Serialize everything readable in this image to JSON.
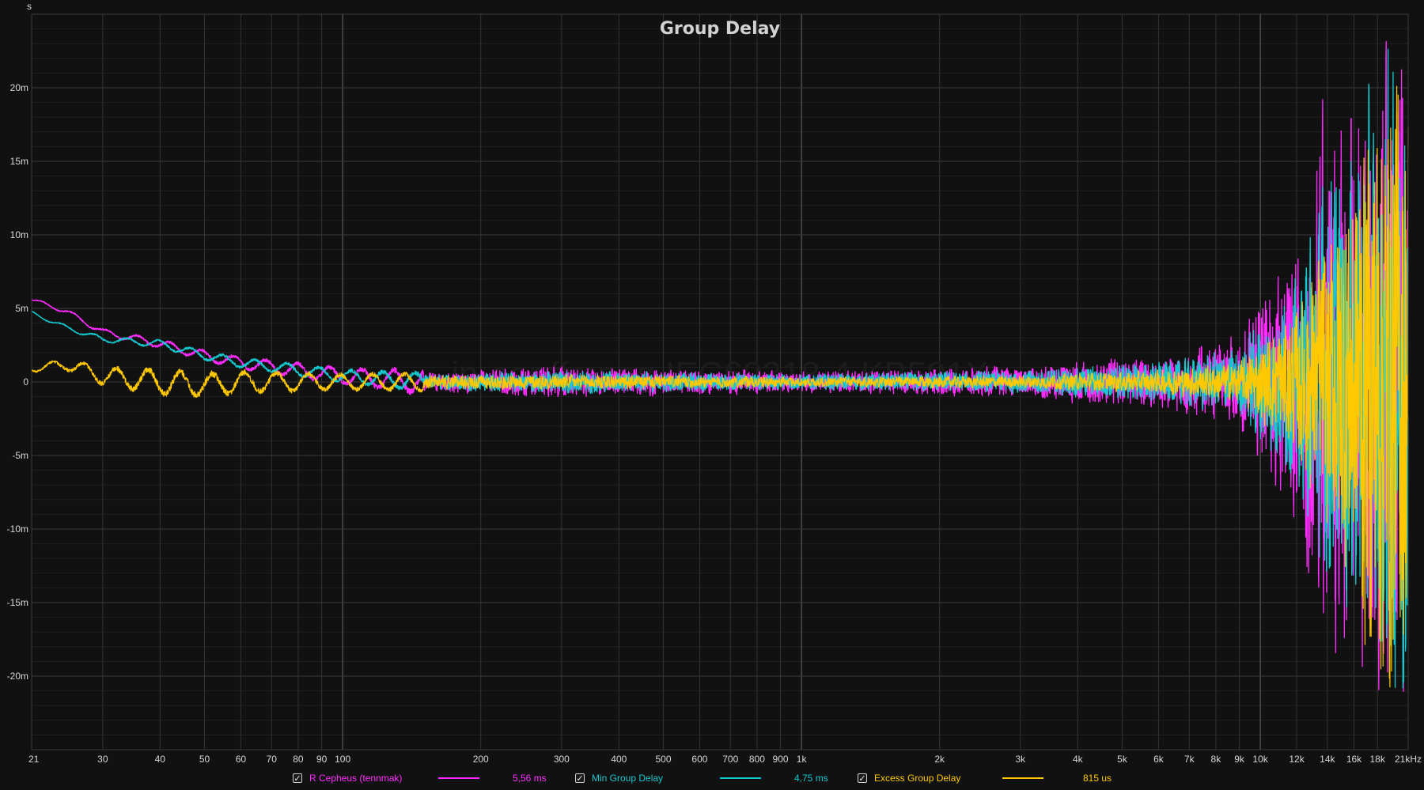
{
  "chart_data": {
    "type": "line",
    "title": "Group Delay",
    "ylabel": "s",
    "watermark": "in-ear ffmpeg IEC60318-4 KB501X",
    "x_scale": "log",
    "xlim": [
      21,
      21000
    ],
    "ylim": [
      -0.025,
      0.025
    ],
    "x_ticks": [
      {
        "v": 21,
        "label": "21"
      },
      {
        "v": 30,
        "label": "30"
      },
      {
        "v": 40,
        "label": "40"
      },
      {
        "v": 50,
        "label": "50"
      },
      {
        "v": 60,
        "label": "60"
      },
      {
        "v": 70,
        "label": "70"
      },
      {
        "v": 80,
        "label": "80"
      },
      {
        "v": 90,
        "label": "90"
      },
      {
        "v": 100,
        "label": "100"
      },
      {
        "v": 200,
        "label": "200"
      },
      {
        "v": 300,
        "label": "300"
      },
      {
        "v": 400,
        "label": "400"
      },
      {
        "v": 500,
        "label": "500"
      },
      {
        "v": 600,
        "label": "600"
      },
      {
        "v": 700,
        "label": "700"
      },
      {
        "v": 800,
        "label": "800"
      },
      {
        "v": 900,
        "label": "900"
      },
      {
        "v": 1000,
        "label": "1k"
      },
      {
        "v": 2000,
        "label": "2k"
      },
      {
        "v": 3000,
        "label": "3k"
      },
      {
        "v": 4000,
        "label": "4k"
      },
      {
        "v": 5000,
        "label": "5k"
      },
      {
        "v": 6000,
        "label": "6k"
      },
      {
        "v": 7000,
        "label": "7k"
      },
      {
        "v": 8000,
        "label": "8k"
      },
      {
        "v": 9000,
        "label": "9k"
      },
      {
        "v": 10000,
        "label": "10k"
      },
      {
        "v": 12000,
        "label": "12k"
      },
      {
        "v": 14000,
        "label": "14k"
      },
      {
        "v": 16000,
        "label": "16k"
      },
      {
        "v": 18000,
        "label": "18k"
      },
      {
        "v": 21000,
        "label": "21kHz"
      }
    ],
    "y_ticks": [
      {
        "v": 0.02,
        "label": "20m"
      },
      {
        "v": 0.015,
        "label": "15m"
      },
      {
        "v": 0.01,
        "label": "10m"
      },
      {
        "v": 0.005,
        "label": "5m"
      },
      {
        "v": 0,
        "label": "0"
      },
      {
        "v": -0.005,
        "label": "-5m"
      },
      {
        "v": -0.01,
        "label": "-10m"
      },
      {
        "v": -0.015,
        "label": "-15m"
      },
      {
        "v": -0.02,
        "label": "-20m"
      }
    ],
    "grid": true,
    "legend_position": "bottom",
    "series": [
      {
        "name": "R Cepheus (tennmak)",
        "value_label": "5,56 ms",
        "color": "#ff2bff",
        "trend": [
          [
            21,
            0.0056
          ],
          [
            25,
            0.0048
          ],
          [
            30,
            0.0034
          ],
          [
            40,
            0.0026
          ],
          [
            50,
            0.0018
          ],
          [
            60,
            0.0013
          ],
          [
            80,
            0.0008
          ],
          [
            100,
            0.0004
          ],
          [
            150,
            0
          ],
          [
            21000,
            0
          ]
        ],
        "envelope": [
          [
            21,
            0.0001
          ],
          [
            100,
            0.0005
          ],
          [
            300,
            0.0012
          ],
          [
            1000,
            0.0008
          ],
          [
            3000,
            0.0012
          ],
          [
            6000,
            0.0022
          ],
          [
            9000,
            0.0035
          ],
          [
            10000,
            0.0075
          ],
          [
            12000,
            0.011
          ],
          [
            14000,
            0.022
          ],
          [
            16000,
            0.022
          ],
          [
            18000,
            0.025
          ],
          [
            21000,
            0.025
          ]
        ]
      },
      {
        "name": "Min Group Delay",
        "value_label": "4,75 ms",
        "color": "#14c8d0",
        "trend": [
          [
            21,
            0.0047
          ],
          [
            25,
            0.0037
          ],
          [
            30,
            0.0029
          ],
          [
            40,
            0.0026
          ],
          [
            50,
            0.0018
          ],
          [
            60,
            0.0013
          ],
          [
            80,
            0.0008
          ],
          [
            100,
            0.0004
          ],
          [
            150,
            0
          ],
          [
            21000,
            0
          ]
        ],
        "envelope": [
          [
            21,
            0.0001
          ],
          [
            100,
            0.0004
          ],
          [
            300,
            0.0009
          ],
          [
            1000,
            0.0006
          ],
          [
            3000,
            0.0009
          ],
          [
            6000,
            0.0016
          ],
          [
            9000,
            0.0026
          ],
          [
            10000,
            0.0055
          ],
          [
            12000,
            0.008
          ],
          [
            14000,
            0.017
          ],
          [
            16000,
            0.019
          ],
          [
            18000,
            0.025
          ],
          [
            21000,
            0.025
          ]
        ]
      },
      {
        "name": "Excess Group Delay",
        "value_label": "815 us",
        "color": "#ffc800",
        "trend": [
          [
            21,
            0.0009
          ],
          [
            25,
            0.0012
          ],
          [
            30,
            0.0004
          ],
          [
            40,
            0.0
          ],
          [
            50,
            -0.0002
          ],
          [
            60,
            0
          ],
          [
            80,
            0
          ],
          [
            100,
            0
          ],
          [
            21000,
            0
          ]
        ],
        "envelope": [
          [
            21,
            0.0002
          ],
          [
            40,
            0.0008
          ],
          [
            100,
            0.0005
          ],
          [
            300,
            0.0006
          ],
          [
            1000,
            0.0004
          ],
          [
            3000,
            0.0005
          ],
          [
            6000,
            0.0009
          ],
          [
            9000,
            0.0016
          ],
          [
            10000,
            0.003
          ],
          [
            12000,
            0.006
          ],
          [
            14000,
            0.012
          ],
          [
            16000,
            0.018
          ],
          [
            18000,
            0.025
          ],
          [
            21000,
            0.025
          ]
        ]
      }
    ]
  }
}
